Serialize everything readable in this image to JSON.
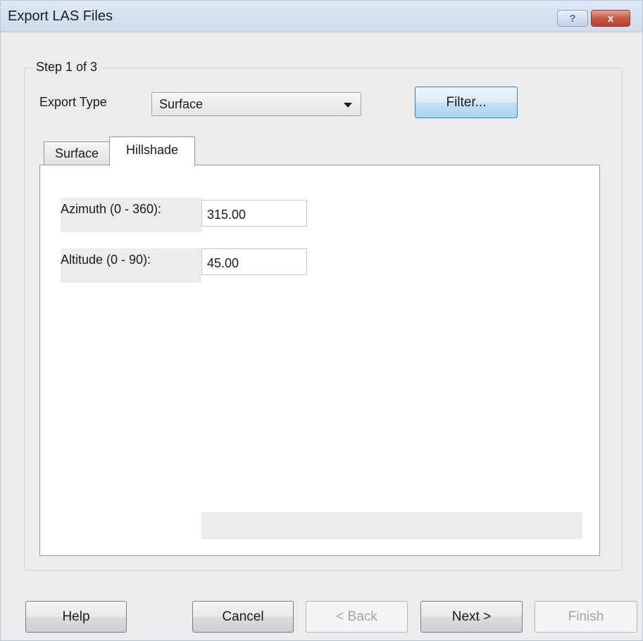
{
  "window": {
    "title": "Export LAS Files",
    "help_glyph": "?",
    "close_glyph": "x"
  },
  "step": {
    "legend": "Step 1 of 3"
  },
  "export_type": {
    "label": "Export Type",
    "value": "Surface"
  },
  "filter_button": "Filter...",
  "tabs": [
    {
      "label": "Surface",
      "active": false
    },
    {
      "label": "Hillshade",
      "active": true
    }
  ],
  "properties": [
    {
      "label": "Azimuth (0 - 360):",
      "value": "315.00"
    },
    {
      "label": "Altitude (0 - 90):",
      "value": "45.00"
    }
  ],
  "footer": {
    "help": "Help",
    "cancel": "Cancel",
    "back": "< Back",
    "next": "Next >",
    "finish": "Finish"
  }
}
